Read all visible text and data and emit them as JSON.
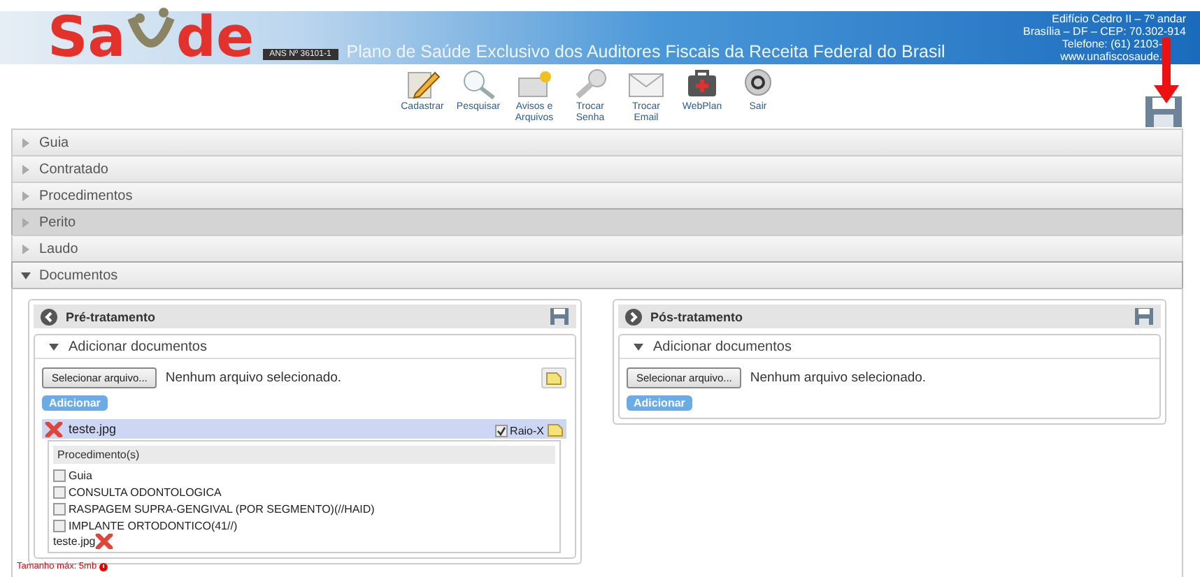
{
  "header": {
    "logo_left": "Sa",
    "logo_right": "de",
    "registration": "ANS Nº 36101-1",
    "tagline": "Plano de Saúde Exclusivo dos Auditores Fiscais da Receita Federal do Brasil",
    "address": [
      "Edifício Cedro II – 7º andar",
      "Brasília – DF – CEP: 70.302-914",
      "Telefone: (61) 2103-",
      "www.unafiscosaude."
    ]
  },
  "toolbar": [
    {
      "label": "Cadastrar"
    },
    {
      "label": "Pesquisar"
    },
    {
      "label": "Avisos e\nArquivos"
    },
    {
      "label": "Trocar\nSenha"
    },
    {
      "label": "Trocar\nEmail"
    },
    {
      "label": "WebPlan"
    },
    {
      "label": "Sair"
    }
  ],
  "sections": [
    {
      "label": "Guia",
      "expanded": false,
      "highlighted": false
    },
    {
      "label": "Contratado",
      "expanded": false,
      "highlighted": false
    },
    {
      "label": "Procedimentos",
      "expanded": false,
      "highlighted": false
    },
    {
      "label": "Perito",
      "expanded": false,
      "highlighted": true
    },
    {
      "label": "Laudo",
      "expanded": false,
      "highlighted": false
    },
    {
      "label": "Documentos",
      "expanded": true,
      "highlighted": false
    }
  ],
  "panels": [
    {
      "title": "Pré-tratamento",
      "kind": "back",
      "subsection": {
        "label": "Adicionar documentos",
        "expanded": true
      },
      "file_button": "Selecionar arquivo...",
      "file_status": "Nenhum arquivo selecionado.",
      "add_button": "Adicionar",
      "has_note": true,
      "attachments": [
        {
          "name": "teste.jpg",
          "xray_label": "Raio-X",
          "xray_checked": true,
          "procedures_heading": "Procedimento(s)",
          "procedures": [
            {
              "label": "Guia",
              "checked": false
            },
            {
              "label": "CONSULTA ODONTOLOGICA",
              "checked": false
            },
            {
              "label": "RASPAGEM SUPRA-GENGIVAL (POR SEGMENTO)(//HAID)",
              "checked": false
            },
            {
              "label": "IMPLANTE ORTODONTICO(41//)",
              "checked": false
            }
          ],
          "footer_file": "teste.jpg"
        }
      ]
    },
    {
      "title": "Pós-tratamento",
      "kind": "forward",
      "subsection": {
        "label": "Adicionar documentos",
        "expanded": true
      },
      "file_button": "Selecionar arquivo...",
      "file_status": "Nenhum arquivo selecionado.",
      "add_button": "Adicionar",
      "has_note": false
    }
  ],
  "size_note": "Tamanho máx: 5mb"
}
